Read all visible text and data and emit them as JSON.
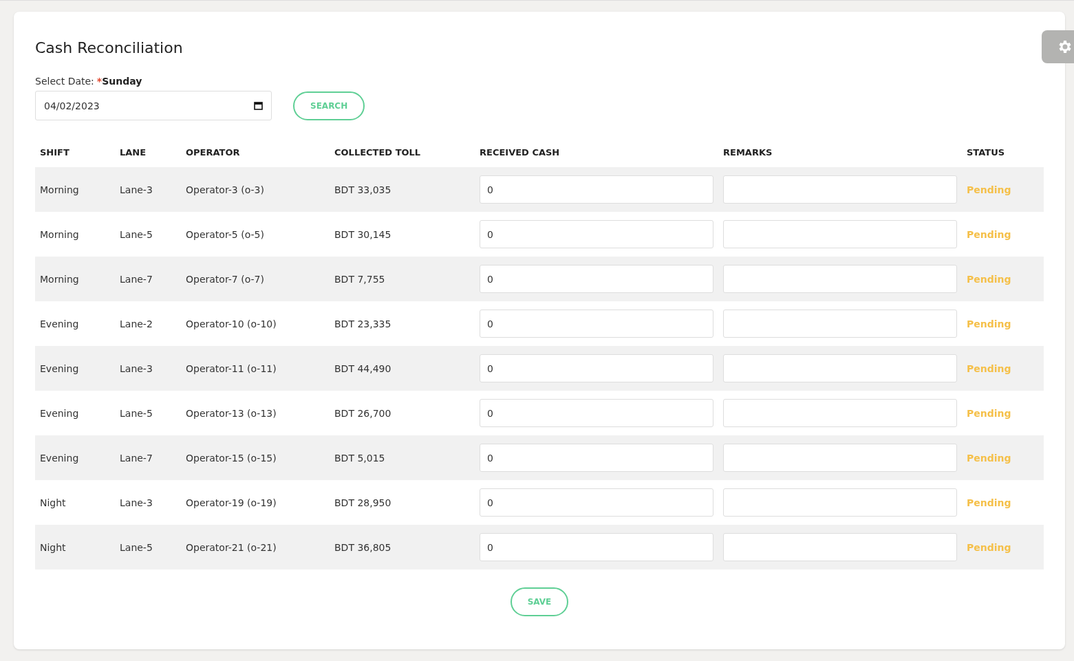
{
  "title": "Cash Reconciliation",
  "date_filter": {
    "label": "Select Date:",
    "required_mark": "*",
    "day": "Sunday",
    "value": "04/02/2023",
    "search_button": "SEARCH"
  },
  "table": {
    "columns": [
      "SHIFT",
      "LANE",
      "OPERATOR",
      "COLLECTED TOLL",
      "RECEIVED CASH",
      "REMARKS",
      "STATUS"
    ],
    "rows": [
      {
        "shift": "Morning",
        "lane": "Lane-3",
        "operator": "Operator-3 (o-3)",
        "collected_toll": "BDT 33,035",
        "received_cash": "0",
        "status": "Pending"
      },
      {
        "shift": "Morning",
        "lane": "Lane-5",
        "operator": "Operator-5 (o-5)",
        "collected_toll": "BDT 30,145",
        "received_cash": "0",
        "status": "Pending"
      },
      {
        "shift": "Morning",
        "lane": "Lane-7",
        "operator": "Operator-7 (o-7)",
        "collected_toll": "BDT 7,755",
        "received_cash": "0",
        "status": "Pending"
      },
      {
        "shift": "Evening",
        "lane": "Lane-2",
        "operator": "Operator-10 (o-10)",
        "collected_toll": "BDT 23,335",
        "received_cash": "0",
        "status": "Pending"
      },
      {
        "shift": "Evening",
        "lane": "Lane-3",
        "operator": "Operator-11 (o-11)",
        "collected_toll": "BDT 44,490",
        "received_cash": "0",
        "status": "Pending"
      },
      {
        "shift": "Evening",
        "lane": "Lane-5",
        "operator": "Operator-13 (o-13)",
        "collected_toll": "BDT 26,700",
        "received_cash": "0",
        "status": "Pending"
      },
      {
        "shift": "Evening",
        "lane": "Lane-7",
        "operator": "Operator-15 (o-15)",
        "collected_toll": "BDT 5,015",
        "received_cash": "0",
        "status": "Pending"
      },
      {
        "shift": "Night",
        "lane": "Lane-3",
        "operator": "Operator-19 (o-19)",
        "collected_toll": "BDT 28,950",
        "received_cash": "0",
        "status": "Pending"
      },
      {
        "shift": "Night",
        "lane": "Lane-5",
        "operator": "Operator-21 (o-21)",
        "collected_toll": "BDT 36,805",
        "received_cash": "0",
        "status": "Pending"
      }
    ]
  },
  "save_button": "SAVE"
}
